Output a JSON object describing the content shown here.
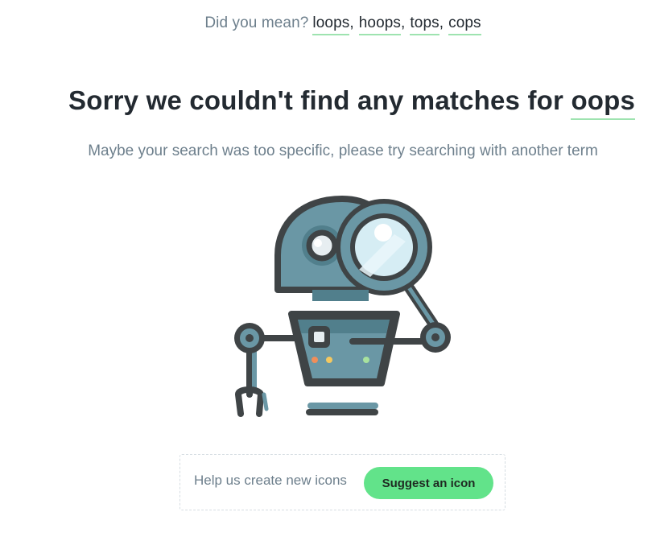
{
  "did_you_mean": {
    "prefix": "Did you mean?",
    "suggestions": [
      "loops",
      "hoops",
      "tops",
      "cops"
    ],
    "separator": ","
  },
  "headline": {
    "text": "Sorry we couldn't find any matches for",
    "term": "oops"
  },
  "subline": "Maybe your search was too specific, please try searching with another term",
  "illustration": {
    "icon": "robot-with-magnifying-glass-icon"
  },
  "suggest": {
    "text": "Help us create new icons",
    "button_label": "Suggest an icon"
  },
  "colors": {
    "accent_green": "#62e38a",
    "underline_green": "#9ee3b0",
    "text_dark": "#232a31",
    "text_muted": "#6d7f8c",
    "robot_body": "#6a97a5",
    "robot_outline": "#3f4446"
  }
}
